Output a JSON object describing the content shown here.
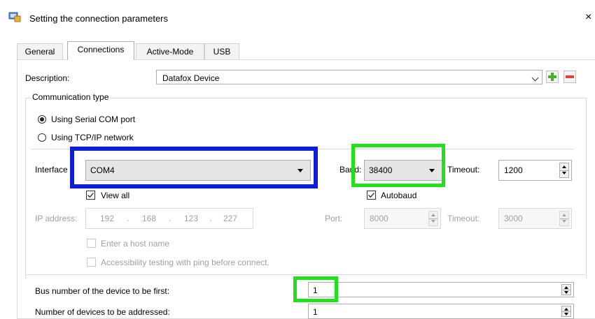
{
  "window": {
    "title": "Setting the connection parameters",
    "close_glyph": "×"
  },
  "tabs": [
    {
      "label": "General"
    },
    {
      "label": "Connections",
      "active": true
    },
    {
      "label": "Active-Mode"
    },
    {
      "label": "USB"
    }
  ],
  "description": {
    "label": "Description:",
    "value": "Datafox Device"
  },
  "communication": {
    "group_label": "Communication type",
    "options": [
      {
        "label": "Using Serial COM port",
        "selected": true
      },
      {
        "label": "Using TCP/IP network",
        "selected": false
      }
    ]
  },
  "serial": {
    "interface_label": "Interface",
    "interface_value": "COM4",
    "view_all_label": "View all",
    "view_all_checked": true,
    "baud_label": "Baud:",
    "baud_value": "38400",
    "autobaud_label": "Autobaud",
    "autobaud_checked": true,
    "timeout_label": "Timeout:",
    "timeout_value": "1200"
  },
  "tcp": {
    "ip_label": "IP address:",
    "ip_octets": [
      "192",
      "168",
      "123",
      "227"
    ],
    "port_label": "Port:",
    "port_value": "8000",
    "timeout_label": "Timeout:",
    "timeout_value": "3000",
    "host_name_label": "Enter a host name",
    "ping_label": "Accessibility testing with ping before connect."
  },
  "bus": {
    "first_label": "Bus number of the device to be first:",
    "first_value": "1",
    "count_label": "Number of devices to be addressed:",
    "count_value": "1"
  },
  "colors": {
    "highlight_blue": "#0d1ed8",
    "highlight_green": "#22e019",
    "plus_green": "#4caf2a",
    "minus_red": "#e04040"
  }
}
